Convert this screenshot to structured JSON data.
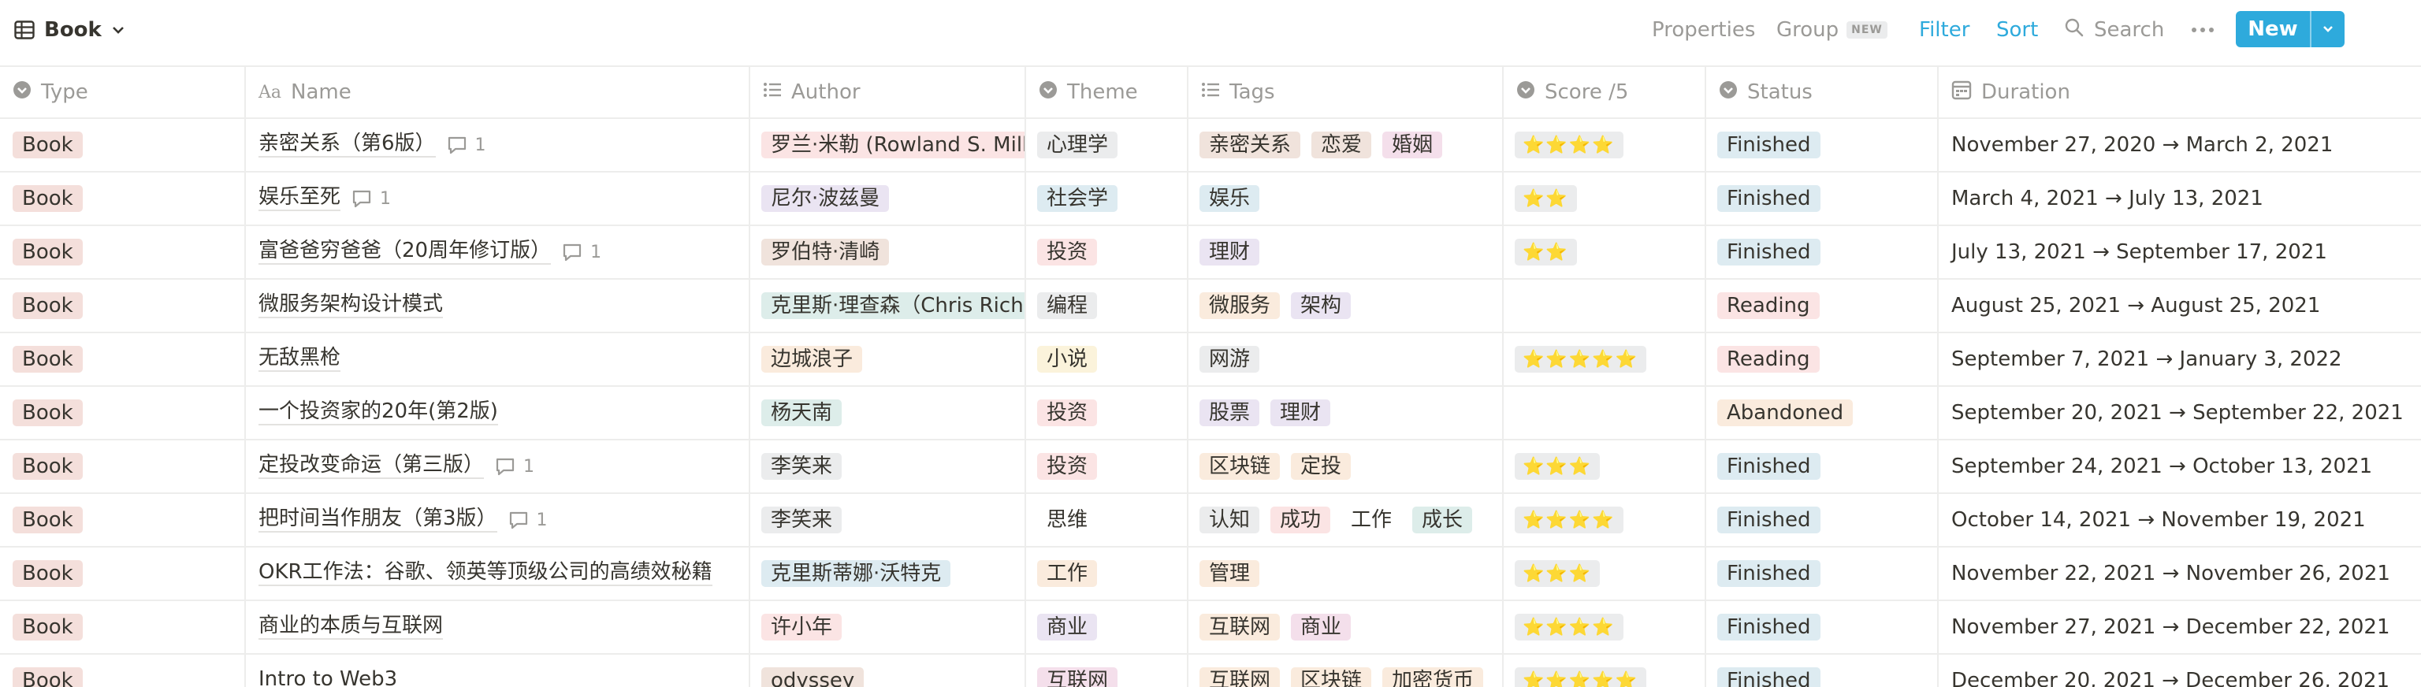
{
  "toolbar": {
    "view_icon": "table-icon",
    "view_name": "Book",
    "properties_label": "Properties",
    "group_label": "Group",
    "group_badge": "NEW",
    "filter_label": "Filter",
    "sort_label": "Sort",
    "search_label": "Search",
    "new_label": "New"
  },
  "columns": {
    "type": "Type",
    "name": "Name",
    "author": "Author",
    "theme": "Theme",
    "tags": "Tags",
    "score": "Score /5",
    "status": "Status",
    "duration": "Duration"
  },
  "colors": {
    "accent": "#2eaadc",
    "type_book_bg": "#f4dfdb",
    "gray_bg": "#ebeced",
    "brown_bg": "#f0e3dc",
    "orange_bg": "#faebdd",
    "yellow_bg": "#fbf3db",
    "green_bg": "#ddedea",
    "blue_bg": "#ddebf1",
    "purple_bg": "#eae4f2",
    "pink_bg": "#f4dfeb",
    "red_bg": "#fbe4e4"
  },
  "rows": [
    {
      "type": "Book",
      "name": "亲密关系（第6版）",
      "comments": "1",
      "author": {
        "text": "罗兰·米勒 (Rowland S. Miller)",
        "color": "#fbe4e4"
      },
      "theme": {
        "text": "心理学",
        "color": "#ebeced"
      },
      "tags": [
        {
          "text": "亲密关系",
          "color": "#f0e3dc"
        },
        {
          "text": "恋爱",
          "color": "#f0e3dc"
        },
        {
          "text": "婚姻",
          "color": "#f4dfeb"
        }
      ],
      "score": "⭐⭐⭐⭐",
      "status": {
        "text": "Finished",
        "color": "#ddebf1"
      },
      "duration": "November 27, 2020 → March 2, 2021"
    },
    {
      "type": "Book",
      "name": "娱乐至死",
      "comments": "1",
      "author": {
        "text": "尼尔·波兹曼",
        "color": "#eae4f2"
      },
      "theme": {
        "text": "社会学",
        "color": "#ddebf1"
      },
      "tags": [
        {
          "text": "娱乐",
          "color": "#ddebf1"
        }
      ],
      "score": "⭐⭐",
      "status": {
        "text": "Finished",
        "color": "#ddebf1"
      },
      "duration": "March 4, 2021 → July 13, 2021"
    },
    {
      "type": "Book",
      "name": "富爸爸穷爸爸（20周年修订版）",
      "comments": "1",
      "author": {
        "text": "罗伯特·清崎",
        "color": "#f0e3dc"
      },
      "theme": {
        "text": "投资",
        "color": "#fbe4e4"
      },
      "tags": [
        {
          "text": "理财",
          "color": "#eae4f2"
        }
      ],
      "score": "⭐⭐",
      "status": {
        "text": "Finished",
        "color": "#ddebf1"
      },
      "duration": "July 13, 2021 → September 17, 2021"
    },
    {
      "type": "Book",
      "name": "微服务架构设计模式",
      "comments": "",
      "author": {
        "text": "克里斯·理查森（Chris Richardson）",
        "color": "#ddedea"
      },
      "theme": {
        "text": "编程",
        "color": "#ebeced"
      },
      "tags": [
        {
          "text": "微服务",
          "color": "#faebdd"
        },
        {
          "text": "架构",
          "color": "#eae4f2"
        }
      ],
      "score": "",
      "status": {
        "text": "Reading",
        "color": "#fbe4e4"
      },
      "duration": "August 25, 2021 → August 25, 2021"
    },
    {
      "type": "Book",
      "name": "无敌黑枪",
      "comments": "",
      "author": {
        "text": "边城浪子",
        "color": "#faebdd"
      },
      "theme": {
        "text": "小说",
        "color": "#fbf3db"
      },
      "tags": [
        {
          "text": "网游",
          "color": "#ebeced"
        }
      ],
      "score": "⭐⭐⭐⭐⭐",
      "status": {
        "text": "Reading",
        "color": "#fbe4e4"
      },
      "duration": "September 7, 2021 → January 3, 2022"
    },
    {
      "type": "Book",
      "name": "一个投资家的20年(第2版)",
      "comments": "",
      "author": {
        "text": "杨天南",
        "color": "#ddedea"
      },
      "theme": {
        "text": "投资",
        "color": "#fbe4e4"
      },
      "tags": [
        {
          "text": "股票",
          "color": "#eae4f2"
        },
        {
          "text": "理财",
          "color": "#eae4f2"
        }
      ],
      "score": "",
      "status": {
        "text": "Abandoned",
        "color": "#faebdd"
      },
      "duration": "September 20, 2021 → September 22, 2021"
    },
    {
      "type": "Book",
      "name": "定投改变命运（第三版）",
      "comments": "1",
      "author": {
        "text": "李笑来",
        "color": "#ebeced"
      },
      "theme": {
        "text": "投资",
        "color": "#fbe4e4"
      },
      "tags": [
        {
          "text": "区块链",
          "color": "#faebdd"
        },
        {
          "text": "定投",
          "color": "#faebdd"
        }
      ],
      "score": "⭐⭐⭐",
      "status": {
        "text": "Finished",
        "color": "#ddebf1"
      },
      "duration": "September 24, 2021 → October 13, 2021"
    },
    {
      "type": "Book",
      "name": "把时间当作朋友（第3版）",
      "comments": "1",
      "author": {
        "text": "李笑来",
        "color": "#ebeced"
      },
      "theme": {
        "text": "思维",
        "color": "#ffffff"
      },
      "tags": [
        {
          "text": "认知",
          "color": "#ebeced"
        },
        {
          "text": "成功",
          "color": "#fbe4e4"
        },
        {
          "text": "工作",
          "color": "#ffffff"
        },
        {
          "text": "成长",
          "color": "#ddedea"
        }
      ],
      "score": "⭐⭐⭐⭐",
      "status": {
        "text": "Finished",
        "color": "#ddebf1"
      },
      "duration": "October 14, 2021 → November 19, 2021"
    },
    {
      "type": "Book",
      "name": "OKR工作法：谷歌、领英等顶级公司的高绩效秘籍",
      "comments": "",
      "author": {
        "text": "克里斯蒂娜·沃特克",
        "color": "#ddebf1"
      },
      "theme": {
        "text": "工作",
        "color": "#faebdd"
      },
      "tags": [
        {
          "text": "管理",
          "color": "#faebdd"
        }
      ],
      "score": "⭐⭐⭐",
      "status": {
        "text": "Finished",
        "color": "#ddebf1"
      },
      "duration": "November 22, 2021 → November 26, 2021"
    },
    {
      "type": "Book",
      "name": "商业的本质与互联网",
      "comments": "",
      "author": {
        "text": "许小年",
        "color": "#fbe4e4"
      },
      "theme": {
        "text": "商业",
        "color": "#eae4f2"
      },
      "tags": [
        {
          "text": "互联网",
          "color": "#faebdd"
        },
        {
          "text": "商业",
          "color": "#f4dfeb"
        }
      ],
      "score": "⭐⭐⭐⭐",
      "status": {
        "text": "Finished",
        "color": "#ddebf1"
      },
      "duration": "November 27, 2021 → December 22, 2021"
    },
    {
      "type": "Book",
      "name": "Intro to Web3",
      "comments": "",
      "author": {
        "text": "odyssey",
        "color": "#f0e3dc"
      },
      "theme": {
        "text": "互联网",
        "color": "#f4dfeb"
      },
      "tags": [
        {
          "text": "互联网",
          "color": "#faebdd"
        },
        {
          "text": "区块链",
          "color": "#faebdd"
        },
        {
          "text": "加密货币",
          "color": "#faebdd"
        }
      ],
      "score": "⭐⭐⭐⭐⭐",
      "status": {
        "text": "Finished",
        "color": "#ddebf1"
      },
      "duration": "December 20, 2021 → December 26, 2021"
    }
  ]
}
